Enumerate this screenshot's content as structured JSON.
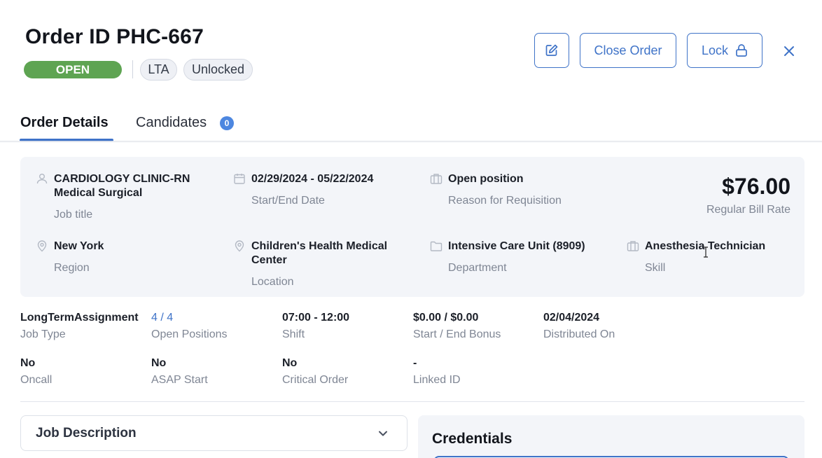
{
  "header": {
    "title": "Order ID PHC-667",
    "status": "OPEN",
    "tags": [
      "LTA",
      "Unlocked"
    ],
    "buttons": {
      "edit_icon": "pencil-square-icon",
      "close_order": "Close Order",
      "lock": "Lock",
      "lock_icon": "lock-icon",
      "close_icon": "close-icon"
    }
  },
  "tabs": [
    {
      "label": "Order Details",
      "active": true
    },
    {
      "label": "Candidates",
      "badge": "0"
    }
  ],
  "summary": {
    "fields": [
      {
        "icon": "user-icon",
        "value": "CARDIOLOGY CLINIC-RN Medical Surgical",
        "label": "Job title"
      },
      {
        "icon": "calendar-icon",
        "value": "02/29/2024 - 05/22/2024",
        "label": "Start/End Date"
      },
      {
        "icon": "briefcase-icon",
        "value": "Open position",
        "label": "Reason for Requisition"
      },
      {
        "icon": "location-pin-icon",
        "value": "New York",
        "label": "Region"
      },
      {
        "icon": "location-pin-icon",
        "value": "Children's Health Medical Center",
        "label": "Location"
      },
      {
        "icon": "folder-icon",
        "value": "Intensive Care Unit (8909)",
        "label": "Department"
      },
      {
        "icon": "briefcase-icon",
        "value": "Anesthesia Technician",
        "label": "Skill"
      }
    ],
    "bill_rate": {
      "value": "$76.00",
      "label": "Regular Bill Rate"
    }
  },
  "details": [
    {
      "value": "LongTermAssignment",
      "label": "Job Type"
    },
    {
      "value": "4 / 4",
      "label": "Open Positions",
      "link": true
    },
    {
      "value": "07:00 - 12:00",
      "label": "Shift"
    },
    {
      "value": "$0.00 / $0.00",
      "label": "Start / End Bonus"
    },
    {
      "value": "02/04/2024",
      "label": "Distributed On"
    },
    {
      "value": "No",
      "label": "Oncall"
    },
    {
      "value": "No",
      "label": "ASAP Start"
    },
    {
      "value": "No",
      "label": "Critical Order"
    },
    {
      "value": "-",
      "label": "Linked ID"
    }
  ],
  "sections": {
    "job_description": "Job Description",
    "credentials": "Credentials"
  },
  "colors": {
    "accent": "#3f73c8",
    "status_open": "#5ea452",
    "badge": "#4d87e0",
    "card_bg": "#f3f5f9"
  }
}
